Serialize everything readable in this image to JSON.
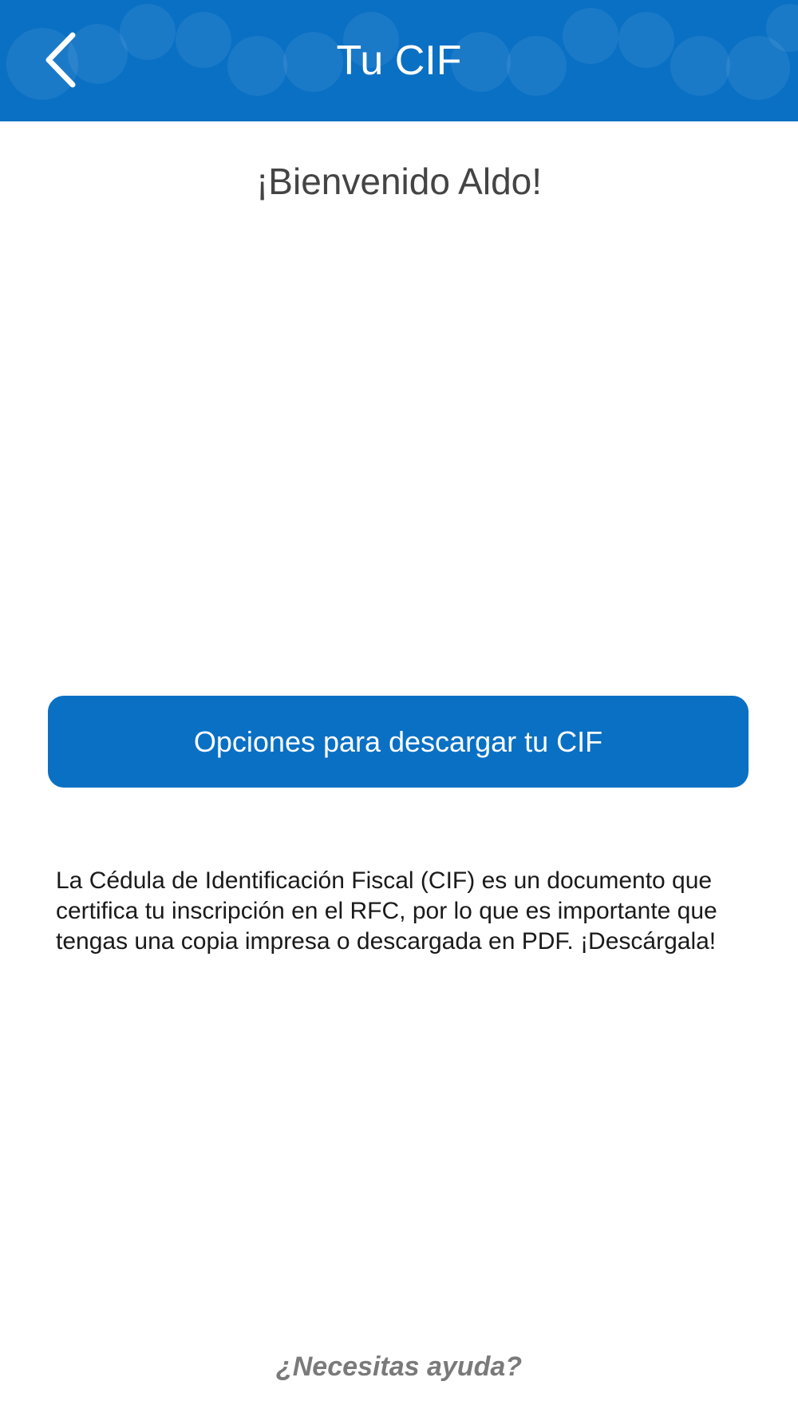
{
  "header": {
    "title": "Tu CIF",
    "back_icon": "chevron-left-icon",
    "background_color": "#0a70c4"
  },
  "main": {
    "welcome_text": "¡Bienvenido Aldo!",
    "download_button_label": "Opciones para descargar tu CIF",
    "description": "La Cédula de Identificación Fiscal (CIF) es un documento que certifica tu inscripción en el RFC, por lo que es importante que tengas una copia impresa o descargada en PDF. ¡Descárgala!"
  },
  "footer": {
    "help_link": "¿Necesitas ayuda?"
  }
}
